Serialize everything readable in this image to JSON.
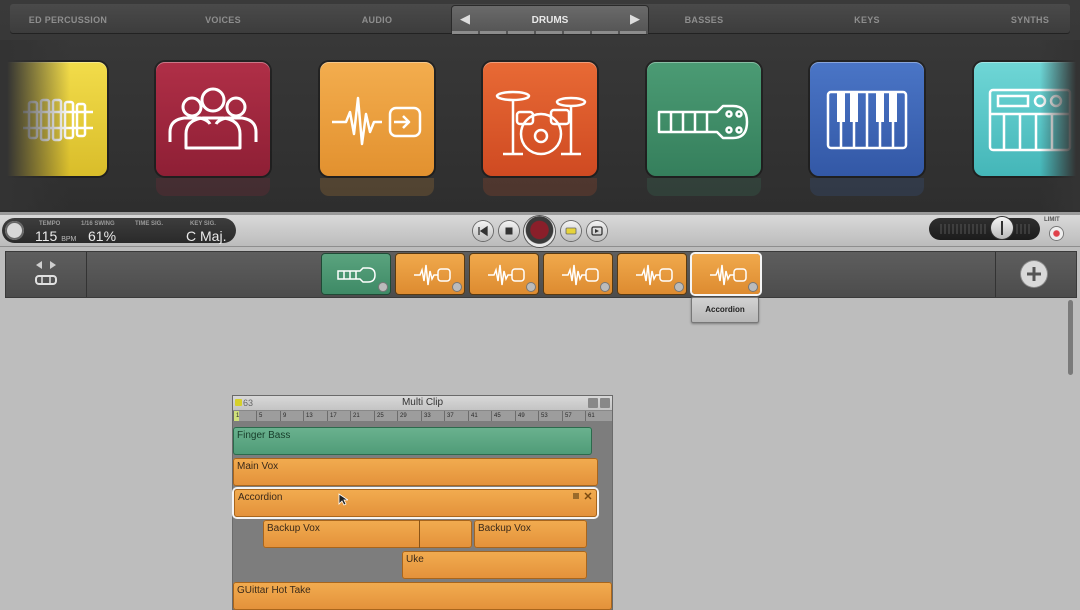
{
  "categories": [
    {
      "label": "ED PERCUSSION"
    },
    {
      "label": "VOICES"
    },
    {
      "label": "AUDIO"
    },
    {
      "label": "BASSES"
    },
    {
      "label": "KEYS"
    },
    {
      "label": "SYNTHS"
    }
  ],
  "active_category": {
    "label": "DRUMS",
    "prev_icon": "triangle-left-icon",
    "next_icon": "triangle-right-icon"
  },
  "instrument_tiles": [
    {
      "icon": "xylophone-icon",
      "color": "#e8cf3a"
    },
    {
      "icon": "voices-group-icon",
      "color": "#a5283e"
    },
    {
      "icon": "audio-waveform-icon",
      "color": "#eea33f"
    },
    {
      "icon": "drum-kit-icon",
      "color": "#e05a2c"
    },
    {
      "icon": "guitar-neck-icon",
      "color": "#3f8e68"
    },
    {
      "icon": "piano-keys-icon",
      "color": "#3d67b8"
    },
    {
      "icon": "synth-icon",
      "color": "#54c8c8"
    }
  ],
  "transport": {
    "tempo_label": "TEMPO",
    "tempo_value": "115",
    "tempo_unit": "BPM",
    "swing_label": "1/16 SWING",
    "swing_value": "61%",
    "timesig_label": "TIME SIG.",
    "keysig_label": "KEY SIG.",
    "keysig_value": "C",
    "keysig_mode": "Maj.",
    "limit_label": "LIMIT",
    "master_volume": 0.6
  },
  "track_strip": {
    "slots": [
      {
        "icon": "guitar-neck-icon",
        "color": "green"
      },
      {
        "icon": "audio-waveform-icon",
        "color": "orange"
      },
      {
        "icon": "audio-waveform-icon",
        "color": "orange"
      },
      {
        "icon": "audio-waveform-icon",
        "color": "orange"
      },
      {
        "icon": "audio-waveform-icon",
        "color": "orange"
      },
      {
        "icon": "audio-waveform-icon",
        "color": "orange",
        "selected": true
      }
    ],
    "tooltip": "Accordion",
    "add_icon": "plus-icon"
  },
  "multi_clip": {
    "title": "Multi Clip",
    "number": "63",
    "ruler": [
      "1",
      "5",
      "9",
      "13",
      "17",
      "21",
      "25",
      "29",
      "33",
      "37",
      "41",
      "45",
      "49",
      "53",
      "57",
      "61"
    ],
    "clips": [
      {
        "label": "Finger Bass",
        "color": "green"
      },
      {
        "label": "Main Vox",
        "color": "orange"
      },
      {
        "label": "Accordion",
        "color": "orange",
        "selected": true
      },
      {
        "label": "Backup Vox",
        "color": "orange"
      },
      {
        "label": "Backup Vox",
        "color": "orange"
      },
      {
        "label": "Uke",
        "color": "orange"
      },
      {
        "label": "GUittar Hot Take",
        "color": "orange"
      }
    ]
  }
}
